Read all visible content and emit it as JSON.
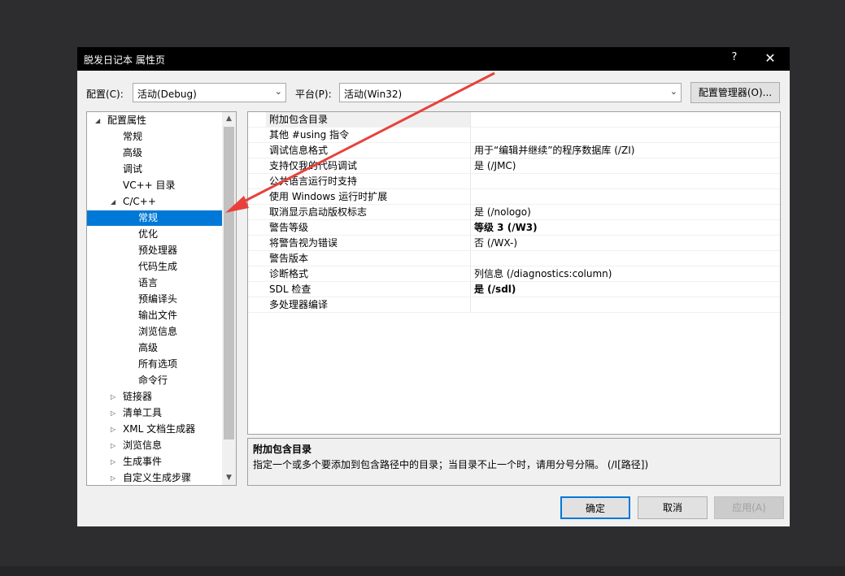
{
  "dialog": {
    "title": "脱发日记本 属性页",
    "help_label": "?",
    "close_label": "✕"
  },
  "top": {
    "config_label": "配置(C):",
    "config_value": "活动(Debug)",
    "platform_label": "平台(P):",
    "platform_value": "活动(Win32)",
    "config_manager_label": "配置管理器(O)..."
  },
  "tree": {
    "items": [
      {
        "label": "配置属性",
        "expander": "◢"
      },
      {
        "label": "常规"
      },
      {
        "label": "高级"
      },
      {
        "label": "调试"
      },
      {
        "label": "VC++ 目录"
      },
      {
        "label": "C/C++",
        "expander": "◢"
      },
      {
        "label": "常规",
        "selected": true
      },
      {
        "label": "优化"
      },
      {
        "label": "预处理器"
      },
      {
        "label": "代码生成"
      },
      {
        "label": "语言"
      },
      {
        "label": "预编译头"
      },
      {
        "label": "输出文件"
      },
      {
        "label": "浏览信息"
      },
      {
        "label": "高级"
      },
      {
        "label": "所有选项"
      },
      {
        "label": "命令行"
      },
      {
        "label": "链接器",
        "expander": "▷"
      },
      {
        "label": "清单工具",
        "expander": "▷"
      },
      {
        "label": "XML 文档生成器",
        "expander": "▷"
      },
      {
        "label": "浏览信息",
        "expander": "▷"
      },
      {
        "label": "生成事件",
        "expander": "▷"
      },
      {
        "label": "自定义生成步骤",
        "expander": "▷"
      }
    ]
  },
  "properties": [
    {
      "name": "附加包含目录",
      "value": ""
    },
    {
      "name": "其他 #using 指令",
      "value": ""
    },
    {
      "name": "调试信息格式",
      "value": "用于“编辑并继续”的程序数据库 (/ZI)"
    },
    {
      "name": "支持仅我的代码调试",
      "value": "是 (/JMC)"
    },
    {
      "name": "公共语言运行时支持",
      "value": ""
    },
    {
      "name": "使用 Windows 运行时扩展",
      "value": ""
    },
    {
      "name": "取消显示启动版权标志",
      "value": "是 (/nologo)"
    },
    {
      "name": "警告等级",
      "value": "等级 3 (/W3)",
      "bold": true
    },
    {
      "name": "将警告视为错误",
      "value": "否 (/WX-)"
    },
    {
      "name": "警告版本",
      "value": ""
    },
    {
      "name": "诊断格式",
      "value": "列信息 (/diagnostics:column)"
    },
    {
      "name": "SDL 检查",
      "value": "是 (/sdl)",
      "bold": true
    },
    {
      "name": "多处理器编译",
      "value": ""
    }
  ],
  "description": {
    "title": "附加包含目录",
    "text": "指定一个或多个要添加到包含路径中的目录；当目录不止一个时，请用分号分隔。     (/I[路径])"
  },
  "buttons": {
    "ok": "确定",
    "cancel": "取消",
    "apply": "应用(A)"
  },
  "colors": {
    "selection": "#0078d7",
    "annotation_arrow": "#e8413c"
  }
}
